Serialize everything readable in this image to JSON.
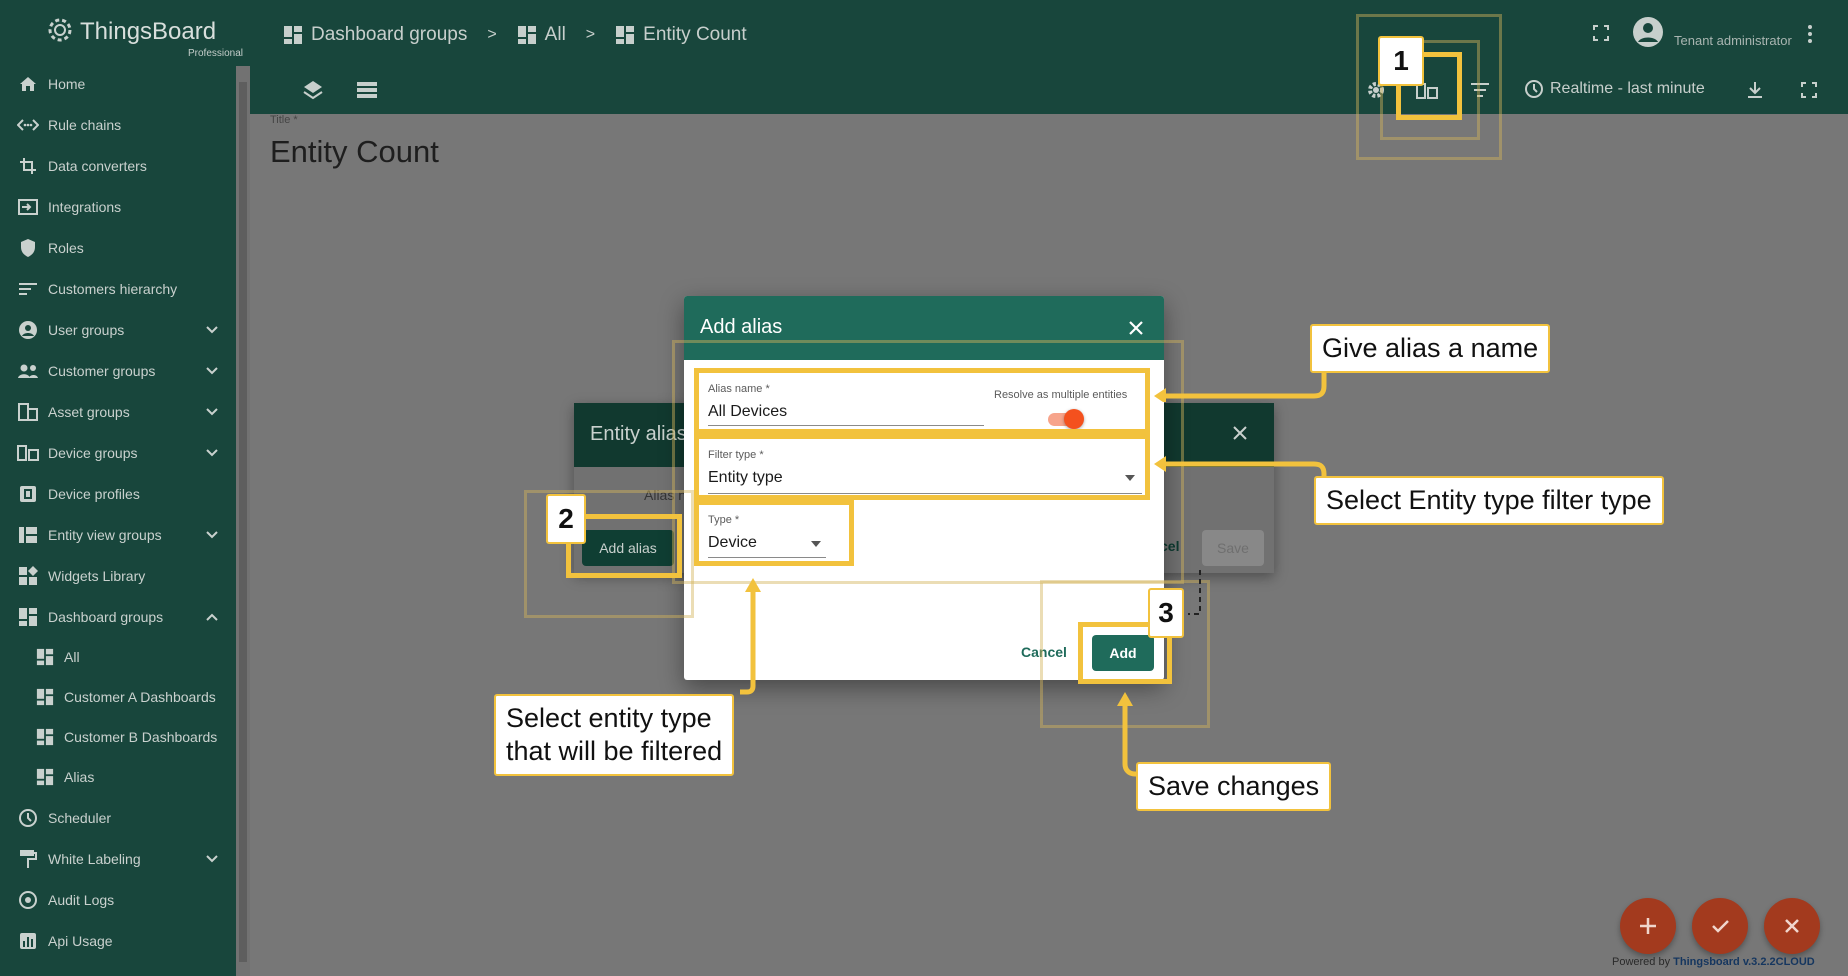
{
  "app": {
    "logo_name": "ThingsBoard",
    "logo_sub": "Professional",
    "user_role": "Tenant administrator"
  },
  "breadcrumbs": [
    {
      "label": "Dashboard groups"
    },
    {
      "label": "All"
    },
    {
      "label": "Entity Count"
    }
  ],
  "toolbar": {
    "timewindow": "Realtime - last minute"
  },
  "sidebar": {
    "items": [
      {
        "label": "Home",
        "icon": "home-icon"
      },
      {
        "label": "Rule chains",
        "icon": "rule-chains-icon"
      },
      {
        "label": "Data converters",
        "icon": "data-converters-icon"
      },
      {
        "label": "Integrations",
        "icon": "integrations-icon"
      },
      {
        "label": "Roles",
        "icon": "roles-icon"
      },
      {
        "label": "Customers hierarchy",
        "icon": "hierarchy-icon"
      },
      {
        "label": "User groups",
        "icon": "user-groups-icon"
      },
      {
        "label": "Customer groups",
        "icon": "customer-groups-icon"
      },
      {
        "label": "Asset groups",
        "icon": "asset-groups-icon"
      },
      {
        "label": "Device groups",
        "icon": "device-groups-icon"
      },
      {
        "label": "Device profiles",
        "icon": "device-profiles-icon"
      },
      {
        "label": "Entity view groups",
        "icon": "entity-view-groups-icon"
      },
      {
        "label": "Widgets Library",
        "icon": "widgets-library-icon"
      },
      {
        "label": "Dashboard groups",
        "icon": "dashboard-groups-icon"
      },
      {
        "label": "All",
        "icon": "dashboard-icon"
      },
      {
        "label": "Customer A Dashboards",
        "icon": "dashboard-icon"
      },
      {
        "label": "Customer B Dashboards",
        "icon": "dashboard-icon"
      },
      {
        "label": "Alias",
        "icon": "dashboard-icon"
      },
      {
        "label": "Scheduler",
        "icon": "scheduler-icon"
      },
      {
        "label": "White Labeling",
        "icon": "white-labeling-icon"
      },
      {
        "label": "Audit Logs",
        "icon": "audit-logs-icon"
      },
      {
        "label": "Api Usage",
        "icon": "api-usage-icon"
      }
    ]
  },
  "dashboard": {
    "title_label": "Title *",
    "title_value": "Entity Count"
  },
  "entity_alias_dialog": {
    "title": "Entity alias",
    "column": "Alias n",
    "add_alias_label": "Add alias",
    "cancel_label": "cel",
    "save_label": "Save"
  },
  "add_alias_dialog": {
    "title": "Add alias",
    "alias_name_label": "Alias name *",
    "alias_name_value": "All Devices",
    "resolve_multiple_label": "Resolve as multiple entities",
    "resolve_multiple_on": true,
    "filter_type_label": "Filter type *",
    "filter_type_value": "Entity type",
    "type_label": "Type *",
    "type_value": "Device",
    "cancel_label": "Cancel",
    "add_label": "Add"
  },
  "annotations": {
    "step1": "1",
    "step2": "2",
    "step3": "3",
    "give_name": "Give alias a name",
    "select_filter": "Select Entity type filter type",
    "select_entity_line1": "Select entity type",
    "select_entity_line2": "that will be filtered",
    "save_changes": "Save changes",
    "highlight_color": "#f2c23d"
  },
  "footer": {
    "powered_prefix": "Powered by",
    "powered_link": "Thingsboard v.3.2.2CLOUD"
  },
  "colors": {
    "primary": "#1f6b5b",
    "header_dark": "#18463c",
    "accent": "#f4511e"
  }
}
